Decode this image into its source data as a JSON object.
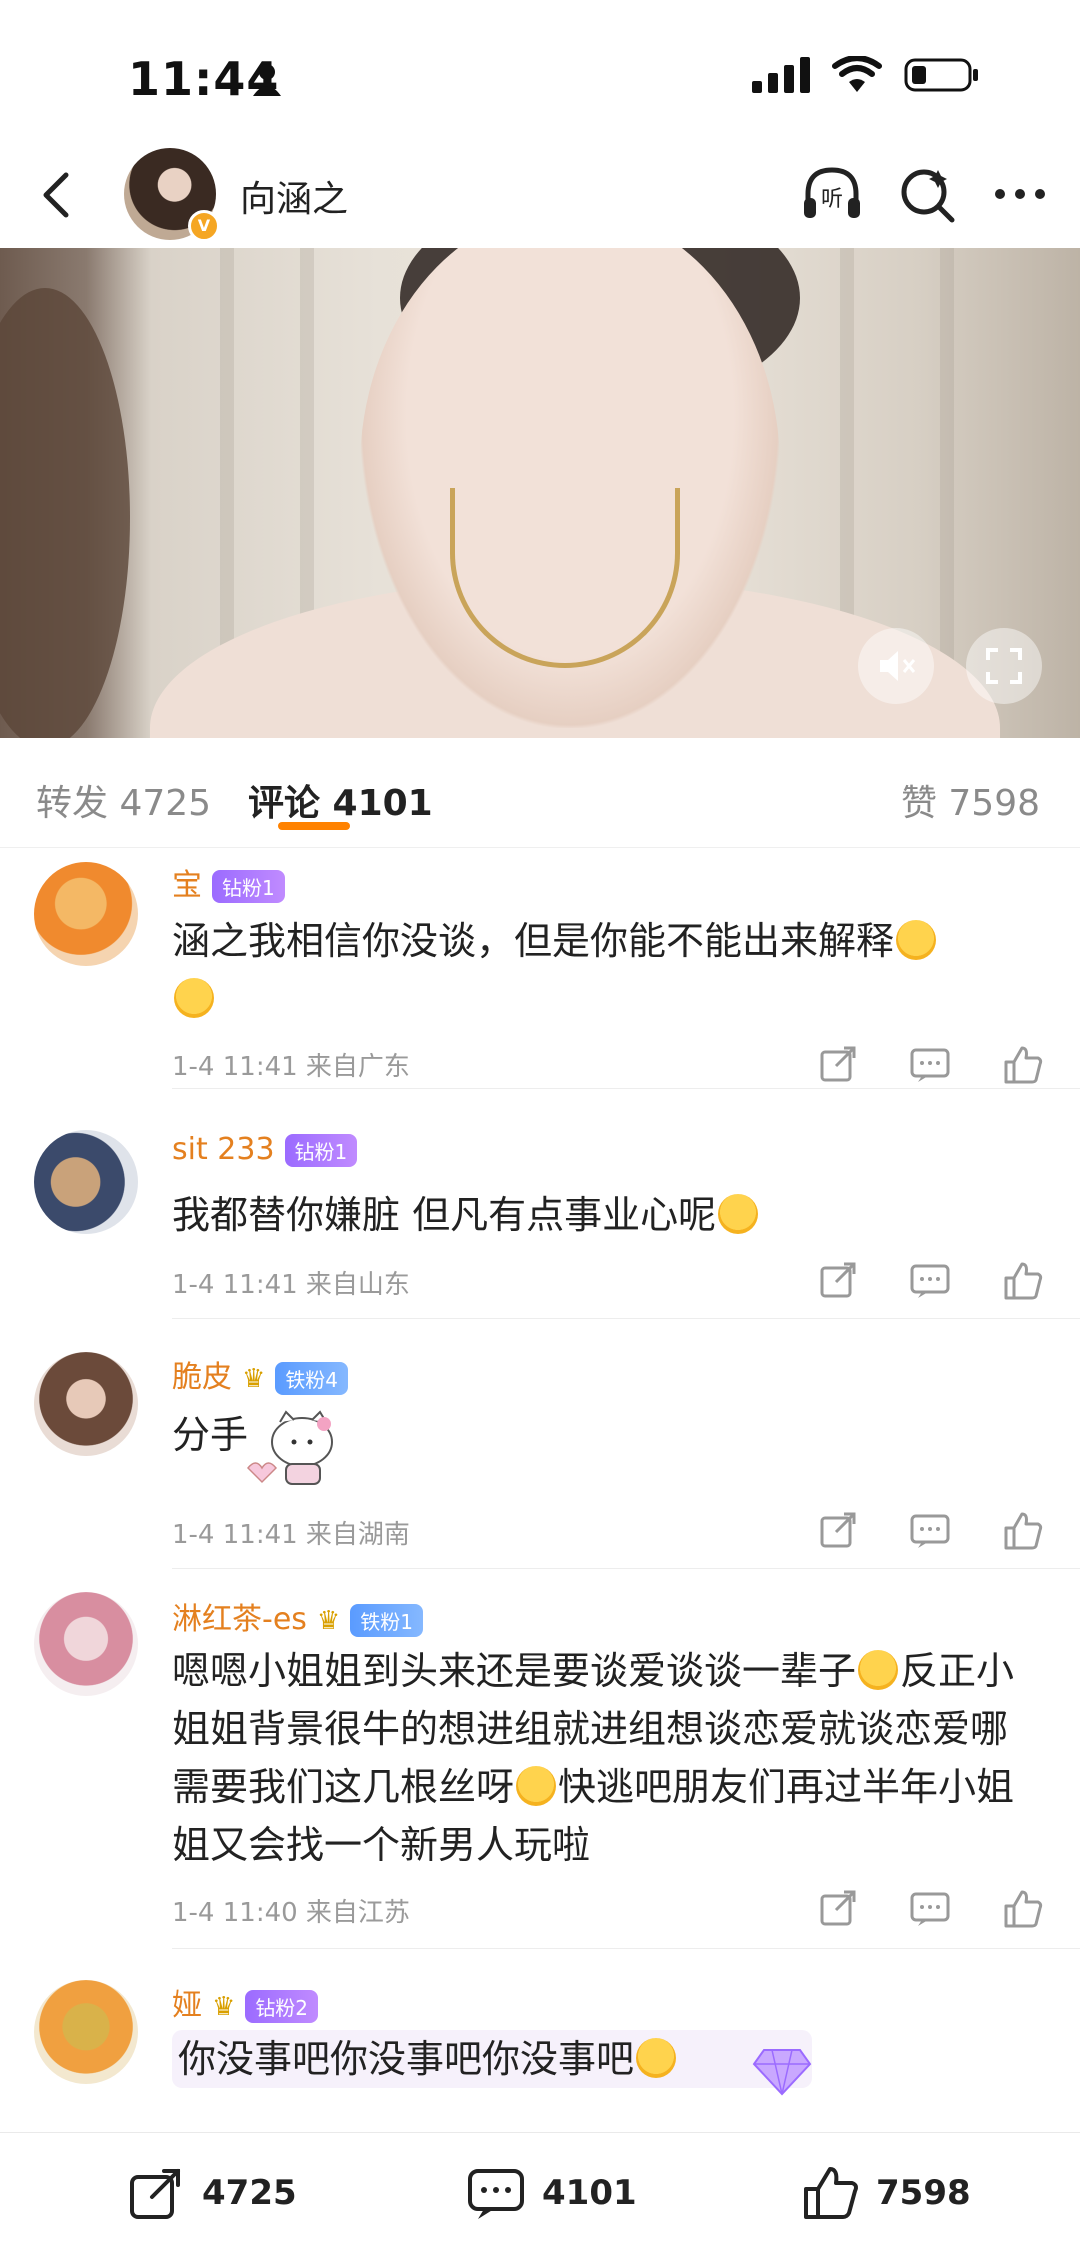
{
  "status_bar": {
    "time": "11:44",
    "icons": [
      "person-icon",
      "signal-icon",
      "wifi-icon",
      "battery-icon"
    ]
  },
  "header": {
    "username": "向涵之",
    "listen_label": "听",
    "icons": [
      "back-icon",
      "listen-icon",
      "search-icon",
      "more-icon"
    ]
  },
  "video": {
    "icons": [
      "mute-icon",
      "fullscreen-icon"
    ]
  },
  "tabs": {
    "repost": "转发 4725",
    "comment": "评论 4101",
    "like": "赞 7598"
  },
  "comments": [
    {
      "name": "宝",
      "badge": "钻粉1",
      "text": "涵之我相信你没谈，但是你能不能出来解释",
      "meta": "1-4 11:41 来自广东"
    },
    {
      "name": "sit    233",
      "badge": "钻粉1",
      "text": "我都替你嫌脏 但凡有点事业心呢",
      "meta": "1-4 11:41 来自山东"
    },
    {
      "name": "脆皮",
      "badge": "铁粉4",
      "text": "分手",
      "meta": "1-4 11:41 来自湖南"
    },
    {
      "name": "淋红茶-es",
      "badge": "铁粉1",
      "text": "嗯嗯小姐姐到头来还是要谈爱谈谈一辈子",
      "text2": "反正小姐姐背景很牛的想进组就进组想谈恋爱就谈恋爱哪需要我们这几根丝呀",
      "text3": "快逃吧朋友们再过半年小姐姐又会找一个新男人玩啦",
      "meta": "1-4 11:40 来自江苏"
    },
    {
      "name": "娅",
      "badge": "钻粉2",
      "text": "你没事吧你没事吧你没事吧"
    }
  ],
  "bottom_bar": {
    "repost_count": "4725",
    "comment_count": "4101",
    "like_count": "7598"
  },
  "colors": {
    "accent": "#ff8200",
    "name_orange": "#e4801f",
    "diamond_badge": "#9b6bff",
    "iron_badge": "#5a9bff"
  }
}
